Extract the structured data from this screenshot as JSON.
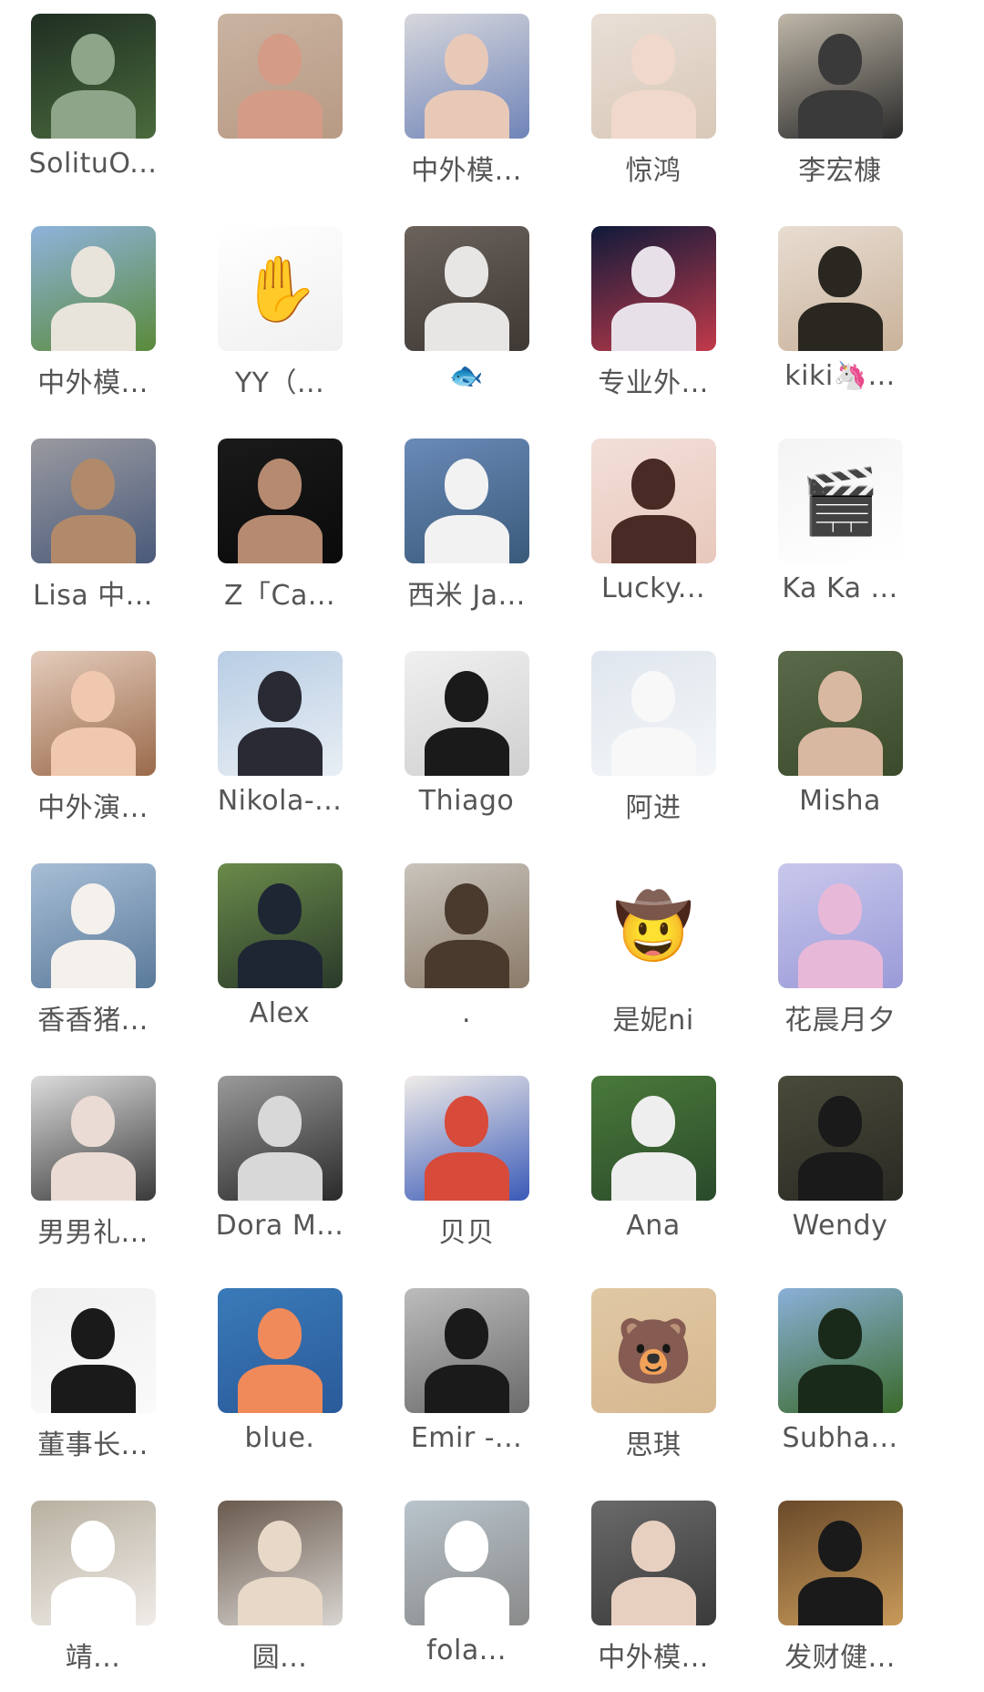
{
  "members": [
    {
      "name": "SolituO...",
      "avatar": {
        "bg": "#1f2e22",
        "bg2": "#4a6a3c",
        "figure": "#8fa58a"
      }
    },
    {
      "name": "",
      "avatar": {
        "bg": "#c9b3a1",
        "bg2": "#b89a84",
        "figure": "#d49b86"
      }
    },
    {
      "name": "中外模...",
      "avatar": {
        "bg": "#d7d7dc",
        "bg2": "#6f84b8",
        "figure": "#e8c9b8"
      }
    },
    {
      "name": "惊鸿",
      "avatar": {
        "bg": "#e9dfd6",
        "bg2": "#d8c8b8",
        "figure": "#f0d8cc"
      }
    },
    {
      "name": "李宏槺",
      "avatar": {
        "bg": "#bfb7a8",
        "bg2": "#2a2a2a",
        "figure": "#3a3a3a"
      }
    },
    {
      "name": "中外模...",
      "avatar": {
        "bg": "#8fb3dc",
        "bg2": "#5a8a3a",
        "figure": "#e8e4dc"
      }
    },
    {
      "name": "YY（...",
      "avatar": {
        "bg": "#ffffff",
        "bg2": "#f0f0f0",
        "figure": "#222222",
        "emblem": "✋"
      }
    },
    {
      "name": "🐟",
      "avatar": {
        "bg": "#6b625c",
        "bg2": "#3e3834",
        "figure": "#e8e6e4"
      }
    },
    {
      "name": "专业外...",
      "avatar": {
        "bg": "#0f1a3a",
        "bg2": "#c23a4a",
        "figure": "#e8e0e8"
      }
    },
    {
      "name": "kiki🦄...",
      "avatar": {
        "bg": "#e8ddd2",
        "bg2": "#c9b29a",
        "figure": "#2a2620"
      }
    },
    {
      "name": "Lisa 中...",
      "avatar": {
        "bg": "#9a9aa0",
        "bg2": "#4a5a7a",
        "figure": "#b08a6a"
      }
    },
    {
      "name": "Z「Ca...",
      "avatar": {
        "bg": "#1a1a1a",
        "bg2": "#0a0a0a",
        "figure": "#b58a70"
      }
    },
    {
      "name": "西米 Ja...",
      "avatar": {
        "bg": "#6a8ab8",
        "bg2": "#3a5a7a",
        "figure": "#f2f2f2"
      }
    },
    {
      "name": "Lucky...",
      "avatar": {
        "bg": "#f2dfd8",
        "bg2": "#e8c8bc",
        "figure": "#4a2a24"
      }
    },
    {
      "name": "Ka Ka ...",
      "avatar": {
        "bg": "#f4f4f4",
        "bg2": "#ffffff",
        "figure": "#3a3a3a",
        "emblem": "🎬"
      }
    },
    {
      "name": "中外演...",
      "avatar": {
        "bg": "#e4ccbc",
        "bg2": "#9a6a4a",
        "figure": "#f0c8b0"
      }
    },
    {
      "name": "Nikola-...",
      "avatar": {
        "bg": "#b8cde4",
        "bg2": "#e8eef4",
        "figure": "#2a2a34"
      }
    },
    {
      "name": "Thiago",
      "avatar": {
        "bg": "#f0f0f0",
        "bg2": "#cfcfcf",
        "figure": "#1a1a1a"
      }
    },
    {
      "name": "阿进",
      "avatar": {
        "bg": "#dfe6ee",
        "bg2": "#f4f6f8",
        "figure": "#f8f8f8"
      }
    },
    {
      "name": "Misha",
      "avatar": {
        "bg": "#5a6a4a",
        "bg2": "#3a4a2a",
        "figure": "#d8b8a0"
      }
    },
    {
      "name": "香香猪...",
      "avatar": {
        "bg": "#a8bed6",
        "bg2": "#5a7a9a",
        "figure": "#f4f0ec"
      }
    },
    {
      "name": "Alex",
      "avatar": {
        "bg": "#6a8a4a",
        "bg2": "#2a3a2a",
        "figure": "#1e2634"
      }
    },
    {
      "name": ".",
      "avatar": {
        "bg": "#c9c4bc",
        "bg2": "#8a7a68",
        "figure": "#4a3a2e"
      }
    },
    {
      "name": "是妮ni",
      "avatar": {
        "bg": "#ffffff",
        "bg2": "#ffffff",
        "figure": "#8a5a3a",
        "emblem": "🤠"
      }
    },
    {
      "name": "花晨月夕",
      "avatar": {
        "bg": "#c8c8ec",
        "bg2": "#9a9ad8",
        "figure": "#e8b8d8"
      }
    },
    {
      "name": "男男礼...",
      "avatar": {
        "bg": "#dcdcdc",
        "bg2": "#3a3a3a",
        "figure": "#eadcd4"
      }
    },
    {
      "name": "Dora M...",
      "avatar": {
        "bg": "#9a9a9a",
        "bg2": "#2a2a2a",
        "figure": "#d8d8d8"
      }
    },
    {
      "name": "贝贝",
      "avatar": {
        "bg": "#f0ece8",
        "bg2": "#3a5ab8",
        "figure": "#d84a3a"
      }
    },
    {
      "name": "Ana",
      "avatar": {
        "bg": "#4a7a3a",
        "bg2": "#2a4a2a",
        "figure": "#eeeeee"
      }
    },
    {
      "name": "Wendy",
      "avatar": {
        "bg": "#4a4a3a",
        "bg2": "#2a2a24",
        "figure": "#1a1a1a"
      }
    },
    {
      "name": "董事长...",
      "avatar": {
        "bg": "#f0f0f0",
        "bg2": "#fafafa",
        "figure": "#1a1a1a"
      }
    },
    {
      "name": "blue.",
      "avatar": {
        "bg": "#3a7ab8",
        "bg2": "#2a5a9a",
        "figure": "#f08a5a"
      }
    },
    {
      "name": "Emir -...",
      "avatar": {
        "bg": "#bcbcbc",
        "bg2": "#6a6a6a",
        "figure": "#1a1a1a"
      }
    },
    {
      "name": "思琪",
      "avatar": {
        "bg": "#e0c8a4",
        "bg2": "#d6b890",
        "figure": "#5a4030",
        "emblem": "🐻"
      }
    },
    {
      "name": "Subha...",
      "avatar": {
        "bg": "#8ab0d8",
        "bg2": "#3a6a2a",
        "figure": "#1a2a1a"
      }
    },
    {
      "name": "靖...",
      "avatar": {
        "bg": "#b8b0a0",
        "bg2": "#f0ece8",
        "figure": "#ffffff"
      }
    },
    {
      "name": "圆...",
      "avatar": {
        "bg": "#6a5a4e",
        "bg2": "#d8d4d0",
        "figure": "#e8d8c8"
      }
    },
    {
      "name": "fola...",
      "avatar": {
        "bg": "#b8c4cc",
        "bg2": "#8a8a8a",
        "figure": "#ffffff"
      }
    },
    {
      "name": "中外模...",
      "avatar": {
        "bg": "#6a6a6a",
        "bg2": "#3a3a3a",
        "figure": "#e8d0c0"
      }
    },
    {
      "name": "发财健...",
      "avatar": {
        "bg": "#6a4a2a",
        "bg2": "#c89a5a",
        "figure": "#1a1a1a"
      }
    }
  ]
}
